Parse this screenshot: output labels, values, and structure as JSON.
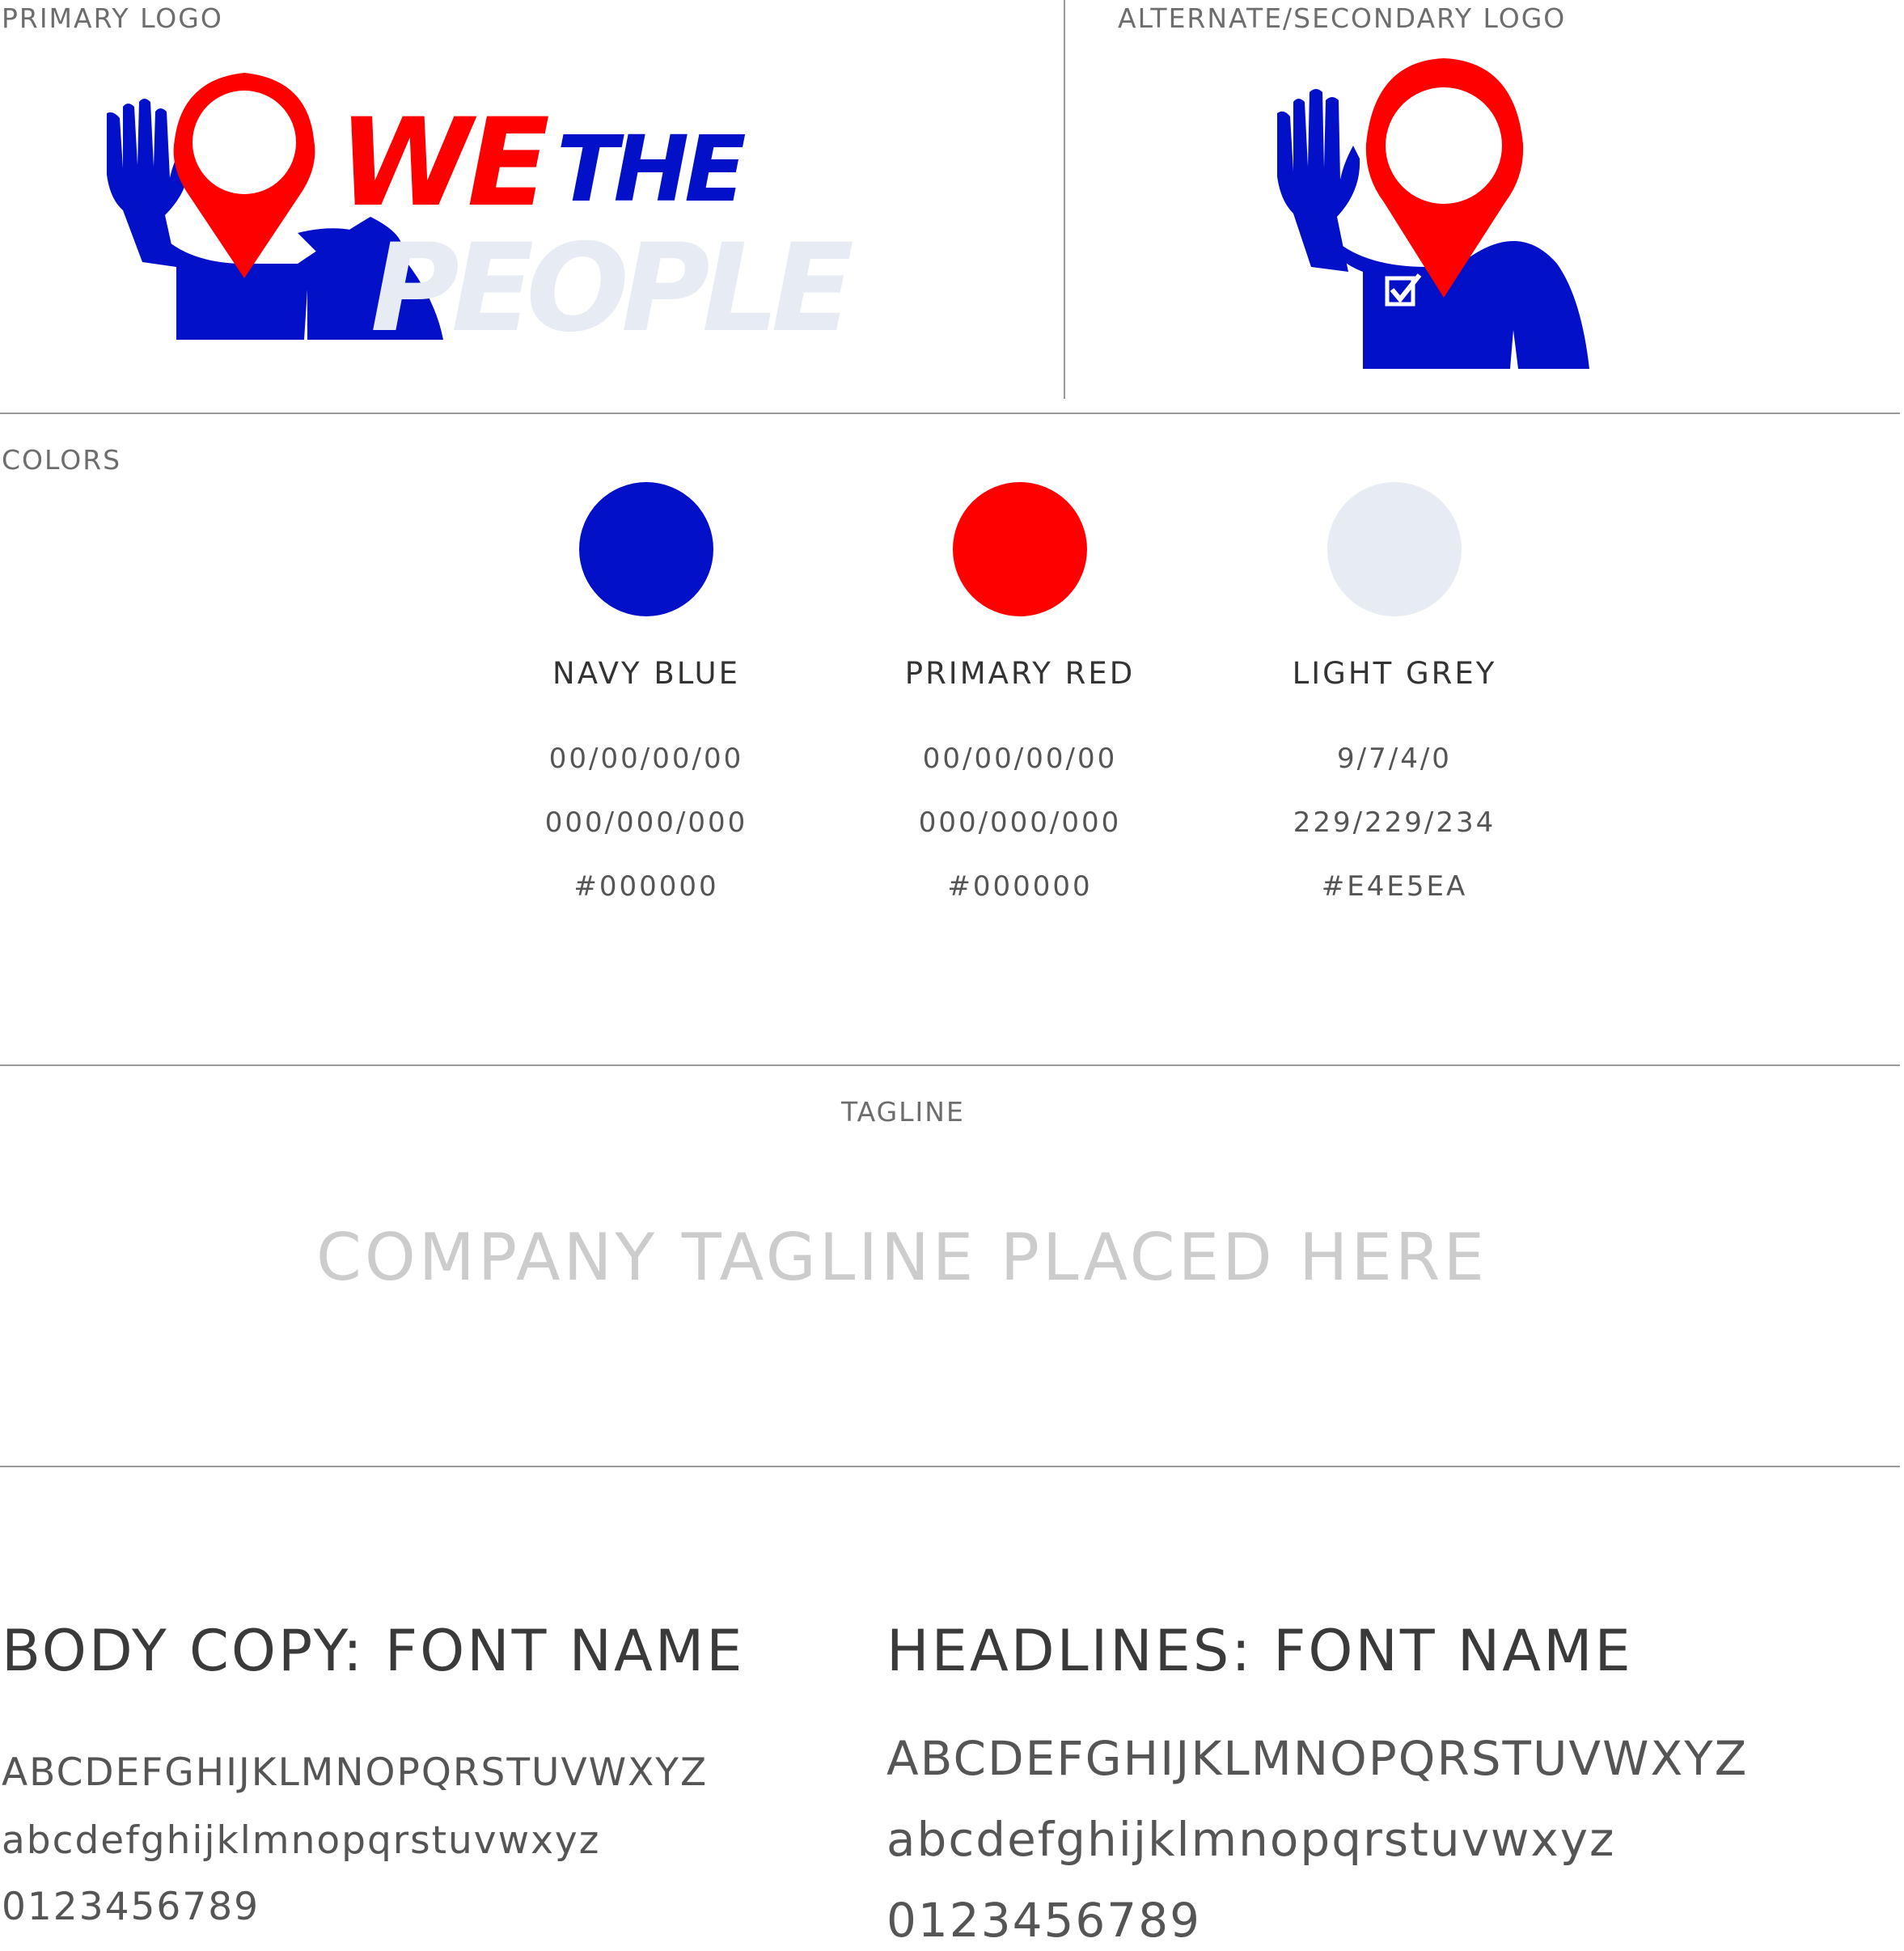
{
  "sections": {
    "primary_logo_label": "PRIMARY LOGO",
    "secondary_logo_label": "ALTERNATE/SECONDARY LOGO",
    "colors_label": "COLORS",
    "tagline_label": "TAGLINE"
  },
  "logo": {
    "word_we": "WE",
    "word_the": "THE",
    "word_people": "PEOPLE"
  },
  "brand_colors": {
    "blue": "#0210C8",
    "red": "#FF0000",
    "light": "#E7ECF4"
  },
  "colors": [
    {
      "name": "NAVY BLUE",
      "swatch": "#0210C8",
      "cmyk": "00/00/00/00",
      "rgb": "000/000/000",
      "hex": "#000000"
    },
    {
      "name": "PRIMARY RED",
      "swatch": "#FF0000",
      "cmyk": "00/00/00/00",
      "rgb": "000/000/000",
      "hex": "#000000"
    },
    {
      "name": "LIGHT GREY",
      "swatch": "#E7ECF4",
      "cmyk": "9/7/4/0",
      "rgb": "229/229/234",
      "hex": "#E4E5EA"
    }
  ],
  "tagline": "COMPANY TAGLINE PLACED HERE",
  "typography": {
    "body": {
      "title": "BODY COPY: FONT NAME",
      "upper": "ABCDEFGHIJKLMNOPQRSTUVWXYZ",
      "lower": "abcdefghijklmnopqrstuvwxyz",
      "digits": "0123456789"
    },
    "headlines": {
      "title": "HEADLINES: FONT NAME",
      "upper": "ABCDEFGHIJKLMNOPQRSTUVWXYZ",
      "lower": "abcdefghijklmnopqrstuvwxyz",
      "digits": "0123456789"
    }
  }
}
